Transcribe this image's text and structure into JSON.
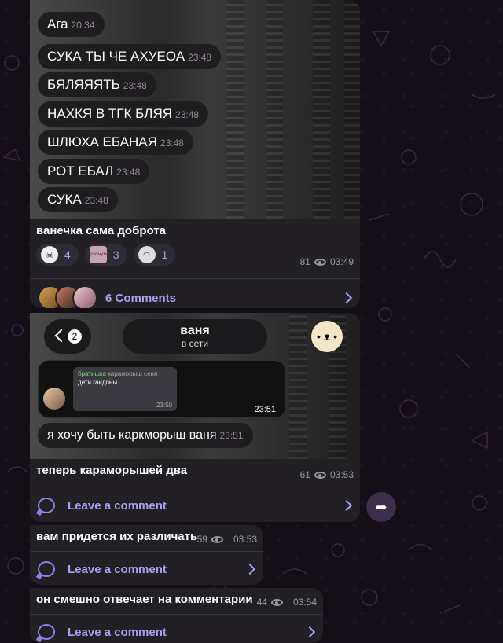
{
  "post1": {
    "messages": [
      {
        "text": "Ага",
        "time": "20:34"
      },
      {
        "text": "СУКА ТЫ ЧЕ АХУЕОА",
        "time": "23:48"
      },
      {
        "text": "БЯЛЯЯЯТЬ",
        "time": "23:48"
      },
      {
        "text": "НАХКЯ В ТГК БЛЯЯ",
        "time": "23:48"
      },
      {
        "text": "ШЛЮХА ЕБАНАЯ",
        "time": "23:48"
      },
      {
        "text": "РОТ ЕБАЛ",
        "time": "23:48"
      },
      {
        "text": "СУКА",
        "time": "23:48"
      }
    ],
    "caption": "ванечка сама доброта",
    "reactions": [
      {
        "emoji": "skull-face",
        "count": "4"
      },
      {
        "emoji": "трахнуть",
        "count": "3"
      },
      {
        "emoji": "ghost",
        "count": "1"
      }
    ],
    "views": "81",
    "time": "03:49",
    "comments_label": "6 Comments"
  },
  "post2": {
    "back_count": "2",
    "chat_name": "ваня",
    "chat_status": "в сети",
    "forward_sender": "братишка",
    "forward_name2": "караморыш сеня",
    "forward_text": "дети гандоны",
    "forward_inner_time": "23:50",
    "forward_time": "23:51",
    "message": {
      "text": "я хочу быть каркморыш ваня",
      "time": "23:51"
    },
    "caption": "теперь караморышей два",
    "views": "61",
    "time": "03:53",
    "comments_label": "Leave a comment"
  },
  "post3": {
    "caption": "вам придется их различать",
    "views": "59",
    "time": "03:53",
    "comments_label": "Leave a comment"
  },
  "post4": {
    "caption": "он смешно отвечает на комментарии",
    "views": "44",
    "time": "03:54",
    "comments_label": "Leave a comment"
  },
  "colors": {
    "accent": "#a99ff0",
    "bubble": "#222024",
    "background": "#140f16"
  }
}
